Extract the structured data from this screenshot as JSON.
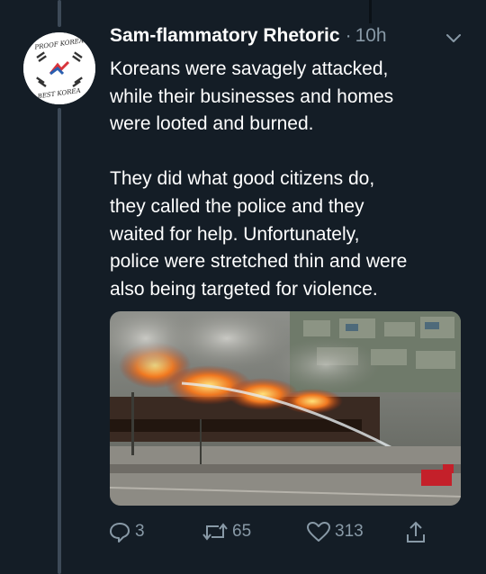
{
  "tweet": {
    "display_name": "Sam-flammatory Rhetoric",
    "separator": "·",
    "time": "10h",
    "text": "Koreans were savagely attacked,\nwhile their businesses and homes\nwere looted and burned.\n\nThey did what good citizens do,\nthey called the police and they\nwaited for help. Unfortunately,\npolice were stretched thin and were\nalso being targeted for violence.",
    "avatar": {
      "top_text": "PROOF KOREA",
      "bottom_text": "BEST KOREA"
    }
  },
  "actions": {
    "reply_count": "3",
    "retweet_count": "65",
    "like_count": "313"
  },
  "icons": {
    "reply": "reply-icon",
    "retweet": "retweet-icon",
    "like": "heart-icon",
    "share": "share-icon",
    "menu": "chevron-down-icon"
  },
  "colors": {
    "background": "#141d26",
    "secondary_text": "#8899a6",
    "thread_line": "#3d4a58"
  }
}
